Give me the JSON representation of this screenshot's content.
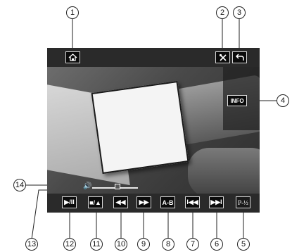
{
  "top_buttons": {
    "home_icon": "home-icon",
    "settings_icon": "settings-icon",
    "back_icon": "back-arrow-icon"
  },
  "info_label": "INFO",
  "bottom_buttons": [
    {
      "id": "play-pause",
      "label": "▶/II"
    },
    {
      "id": "aspect",
      "label": "■/▲"
    },
    {
      "id": "rewind",
      "label": "◀◀"
    },
    {
      "id": "fast-forward",
      "label": "▶▶"
    },
    {
      "id": "ab-repeat",
      "label": "A-B"
    },
    {
      "id": "previous",
      "label": "I◀◀"
    },
    {
      "id": "next",
      "label": "▶▶I"
    },
    {
      "id": "page",
      "label": "P-½"
    }
  ],
  "volume": {
    "level": 0.55
  },
  "callouts": [
    "1",
    "2",
    "3",
    "4",
    "5",
    "6",
    "7",
    "8",
    "9",
    "10",
    "11",
    "12",
    "13",
    "14"
  ]
}
